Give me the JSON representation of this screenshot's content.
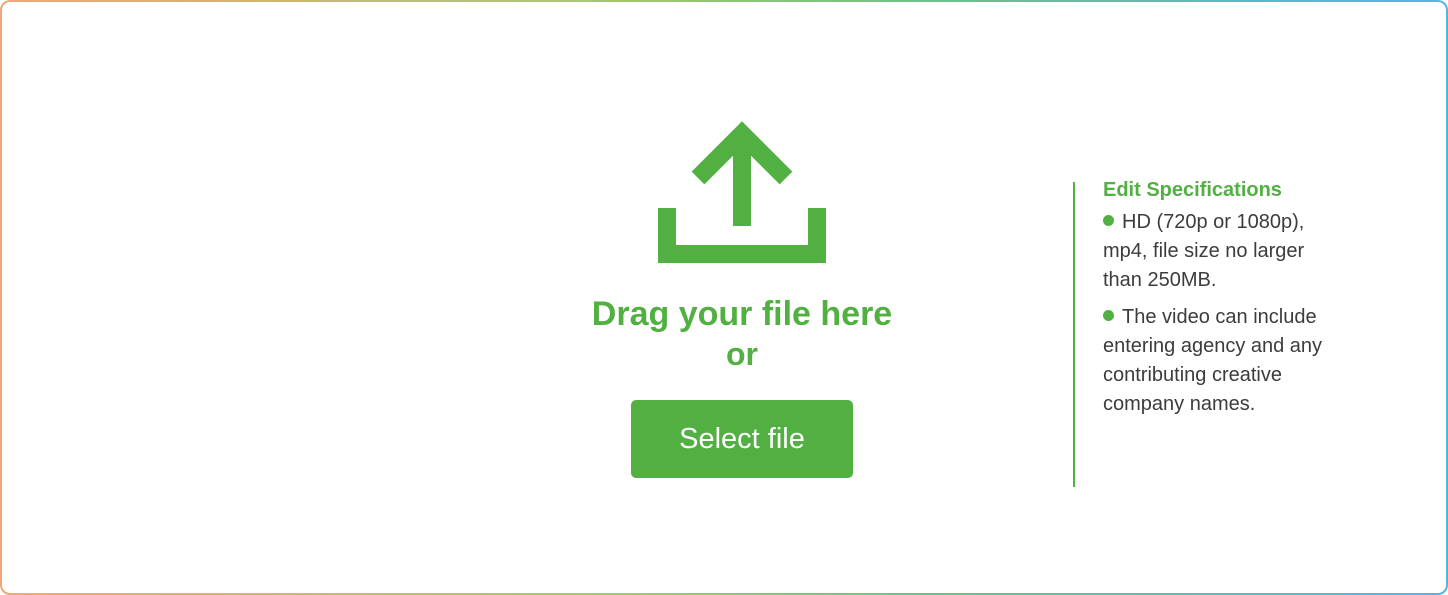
{
  "upload": {
    "icon": "upload-icon",
    "drag_text": "Drag your file here",
    "or_text": "or",
    "select_button_label": "Select file"
  },
  "specs": {
    "title": "Edit Specifications",
    "items": [
      "HD (720p or 1080p), mp4, file size no larger than 250MB.",
      "The video can include entering agency and any contributing creative company names."
    ]
  },
  "colors": {
    "accent": "#52b043",
    "text": "#3c3c3c",
    "frame_gradient": [
      "#f0a77a",
      "#a9c86a",
      "#6cc08a",
      "#4fb7e6"
    ]
  }
}
